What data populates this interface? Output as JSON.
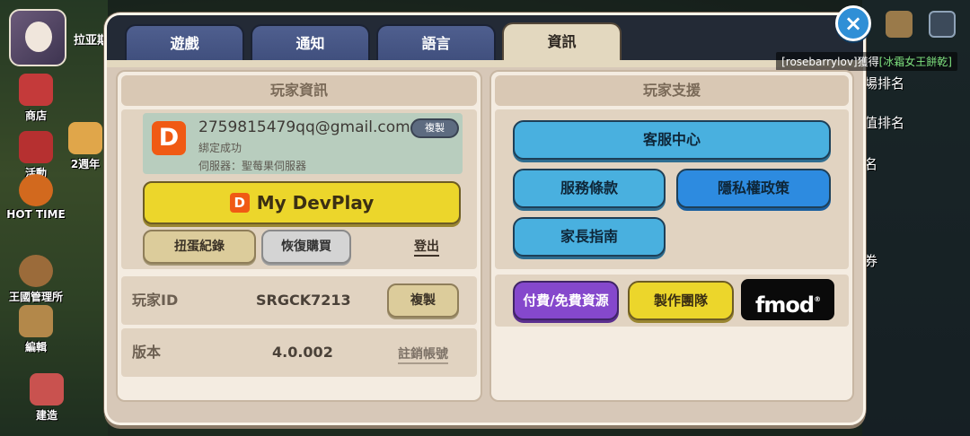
{
  "background": {
    "player_name": "拉亚斯",
    "side_buttons": [
      {
        "label": "商店",
        "icon": "shop-icon"
      },
      {
        "label": "活動",
        "icon": "gift-icon"
      },
      {
        "label": "2週年",
        "icon": "anniversary-icon"
      },
      {
        "label": "HOT TIME",
        "icon": "hot-time-icon"
      },
      {
        "label": "王國管理所",
        "icon": "kingdom-office-icon"
      },
      {
        "label": "編輯",
        "icon": "edit-icon"
      },
      {
        "label": "建造",
        "icon": "build-icon"
      }
    ],
    "right_items": [
      "場排名",
      "值排名",
      "名",
      "券"
    ]
  },
  "chat": {
    "user": "[rosebarrylov]",
    "verb": "獲得",
    "item": "[冰霜女王餅乾]"
  },
  "tabs": [
    {
      "label": "遊戲",
      "active": false
    },
    {
      "label": "通知",
      "active": false
    },
    {
      "label": "語言",
      "active": false
    },
    {
      "label": "資訊",
      "active": true
    }
  ],
  "close_icon": "×",
  "player_info": {
    "title": "玩家資訊",
    "account": {
      "logo_letter": "D",
      "email": "2759815479qq@gmail.com",
      "bind_status": "綁定成功",
      "server": "伺服器：聖莓果伺服器",
      "copy_label": "複製"
    },
    "devplay_label": "My DevPlay",
    "gacha_label": "扭蛋紀錄",
    "restore_label": "恢復購買",
    "logout_label": "登出",
    "player_id_label": "玩家ID",
    "player_id_value": "SRGCK7213",
    "player_id_copy": "複製",
    "version_label": "版本",
    "version_value": "4.0.002",
    "delete_account_label": "註銷帳號"
  },
  "support": {
    "title": "玩家支援",
    "customer_center": "客服中心",
    "terms": "服務條款",
    "privacy": "隱私權政策",
    "parent_guide": "家長指南",
    "paid_free": "付費/免費資源",
    "credits": "製作團隊",
    "fmod": "fmod",
    "fmod_reg": "®"
  },
  "colors": {
    "active_tab": "#e3d8bf",
    "tab": "#4f5f8f",
    "blue_button": "#49b0df",
    "yellow_button": "#ecd62b",
    "purple_button": "#8548cc",
    "devplay_orange": "#f05a14"
  }
}
